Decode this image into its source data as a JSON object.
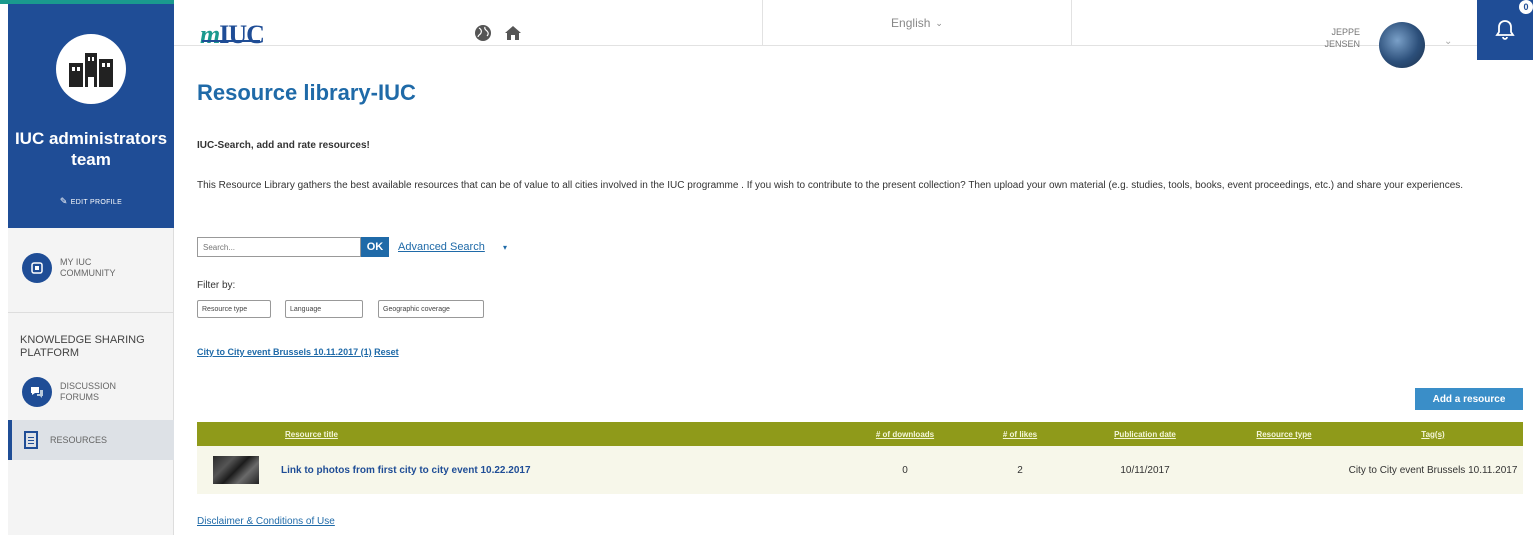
{
  "header": {
    "logo_text": "IUC",
    "logo_prefix": "m",
    "language": "English",
    "user_first": "JEPPE",
    "user_last": "JENSEN",
    "notif_count": "0"
  },
  "sidebar": {
    "team_name": "IUC administrators team",
    "edit_profile": "EDIT PROFILE",
    "my_community": "MY IUC COMMUNITY",
    "section_title": "KNOWLEDGE SHARING PLATFORM",
    "items": [
      {
        "label": "DISCUSSION FORUMS"
      },
      {
        "label": "RESOURCES"
      }
    ]
  },
  "main": {
    "title": "Resource library-IUC",
    "subtitle": "IUC-Search, add and rate resources!",
    "intro": "This Resource Library gathers the best available resources that can be of value to all cities involved in the IUC programme . If you wish to contribute to the present collection? Then upload your own material (e.g. studies, tools, books, event proceedings, etc.) and share your experiences.",
    "search": {
      "placeholder": "Search...",
      "ok_label": "OK",
      "advanced_label": "Advanced Search"
    },
    "filter": {
      "label": "Filter by:",
      "options": [
        "Resource type",
        "Language",
        "Geographic coverage"
      ]
    },
    "active_filter": "City to City event Brussels 10.11.2017 (1)",
    "reset_label": "Reset",
    "add_resource_label": "Add a resource",
    "table": {
      "columns": [
        "",
        "Resource title",
        "# of downloads",
        "# of likes",
        "Publication date",
        "Resource type",
        "Tag(s)"
      ],
      "rows": [
        {
          "title": "Link to photos from first city to city event 10.22.2017",
          "downloads": "0",
          "likes": "2",
          "date": "10/11/2017",
          "type": "",
          "tags": "City to City event Brussels 10.11.2017"
        }
      ]
    },
    "disclaimer": "Disclaimer & Conditions of Use"
  },
  "colors": {
    "brand_blue": "#1f4d96",
    "teal": "#1a9a8e",
    "table_header": "#8f9a1a",
    "link": "#1f6aa8"
  }
}
